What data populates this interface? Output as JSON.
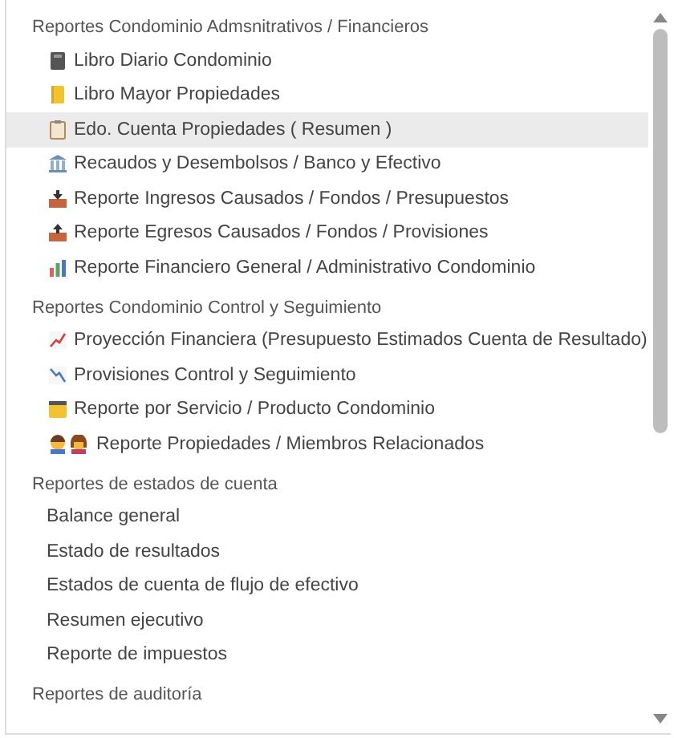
{
  "groups": [
    {
      "title": "Reportes Condominio Admsnitrativos / Financieros",
      "items": [
        {
          "label": "Libro Diario Condominio",
          "kind": "notebook",
          "selected": false
        },
        {
          "label": "Libro Mayor Propiedades",
          "kind": "ledger",
          "selected": false
        },
        {
          "label": "Edo. Cuenta Propiedades ( Resumen )",
          "kind": "clipboard",
          "selected": true
        },
        {
          "label": "Recaudos y Desembolsos / Banco y Efectivo",
          "kind": "bank",
          "selected": false
        },
        {
          "label": "Reporte Ingresos Causados / Fondos / Presupuestos",
          "kind": "inbox",
          "selected": false
        },
        {
          "label": "Reporte Egresos Causados / Fondos / Provisiones",
          "kind": "outbox",
          "selected": false
        },
        {
          "label": "Reporte Financiero General / Administrativo Condominio",
          "kind": "barchart",
          "selected": false
        }
      ]
    },
    {
      "title": "Reportes Condominio Control y Seguimiento",
      "items": [
        {
          "label": "Proyección Financiera (Presupuesto Estimados Cuenta de Resultado)",
          "kind": "trendup",
          "selected": false
        },
        {
          "label": "Provisiones Control y Seguimiento",
          "kind": "trenddown",
          "selected": false
        },
        {
          "label": "Reporte por Servicio / Producto Condominio",
          "kind": "folder",
          "selected": false
        },
        {
          "label": "Reporte Propiedades / Miembros Relacionados",
          "kind": "people",
          "selected": false
        }
      ]
    },
    {
      "title": "Reportes de estados de cuenta",
      "items": [
        {
          "label": "Balance general",
          "selected": false
        },
        {
          "label": "Estado de resultados",
          "selected": false
        },
        {
          "label": "Estados de cuenta de flujo de efectivo",
          "selected": false
        },
        {
          "label": "Resumen ejecutivo",
          "selected": false
        },
        {
          "label": "Reporte de impuestos",
          "selected": false
        }
      ]
    },
    {
      "title": "Reportes de auditoría"
    }
  ]
}
